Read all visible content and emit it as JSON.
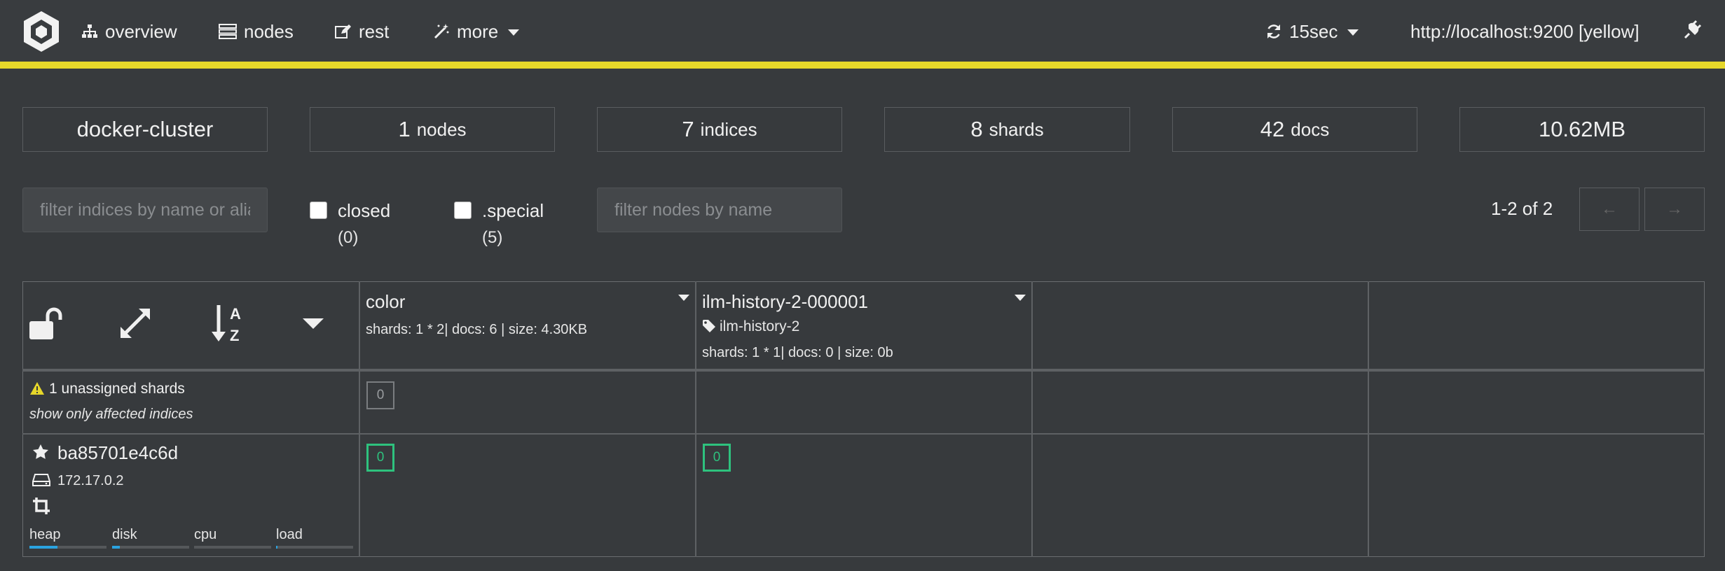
{
  "nav": {
    "overview": "overview",
    "nodes": "nodes",
    "rest": "rest",
    "more": "more",
    "refresh": "15sec",
    "cluster_url": "http://localhost:9200 [yellow]"
  },
  "colors": {
    "cluster_status": "#e6d72a",
    "shard_active": "#2ec27e",
    "accent": "#2aa3e0"
  },
  "stats": {
    "cluster_name": "docker-cluster",
    "nodes_value": "1",
    "nodes_label": "nodes",
    "indices_value": "7",
    "indices_label": "indices",
    "shards_value": "8",
    "shards_label": "shards",
    "docs_value": "42",
    "docs_label": "docs",
    "size": "10.62MB"
  },
  "filters": {
    "index_placeholder": "filter indices by name or aliases",
    "closed_label": "closed",
    "closed_count": "(0)",
    "special_label": ".special",
    "special_count": "(5)",
    "node_placeholder": "filter nodes by name"
  },
  "pager": {
    "text": "1-2 of 2",
    "prev": "←",
    "next": "→"
  },
  "indices": [
    {
      "name": "color",
      "alias": "",
      "meta": "shards: 1 * 2| docs: 6 | size: 4.30KB"
    },
    {
      "name": "ilm-history-2-000001",
      "alias": "ilm-history-2",
      "meta": "shards: 1 * 1| docs: 0 | size: 0b"
    }
  ],
  "unassigned": {
    "text": "1 unassigned shards",
    "link": "show only affected indices",
    "shards": [
      "0"
    ]
  },
  "node": {
    "name": "ba85701e4c6d",
    "ip": "172.17.0.2",
    "shards": [
      "0",
      "0"
    ],
    "metrics": [
      {
        "label": "heap",
        "fraction": 0.36
      },
      {
        "label": "disk",
        "fraction": 0.1
      },
      {
        "label": "cpu",
        "fraction": 0.0
      },
      {
        "label": "load",
        "fraction": 0.02
      }
    ]
  }
}
